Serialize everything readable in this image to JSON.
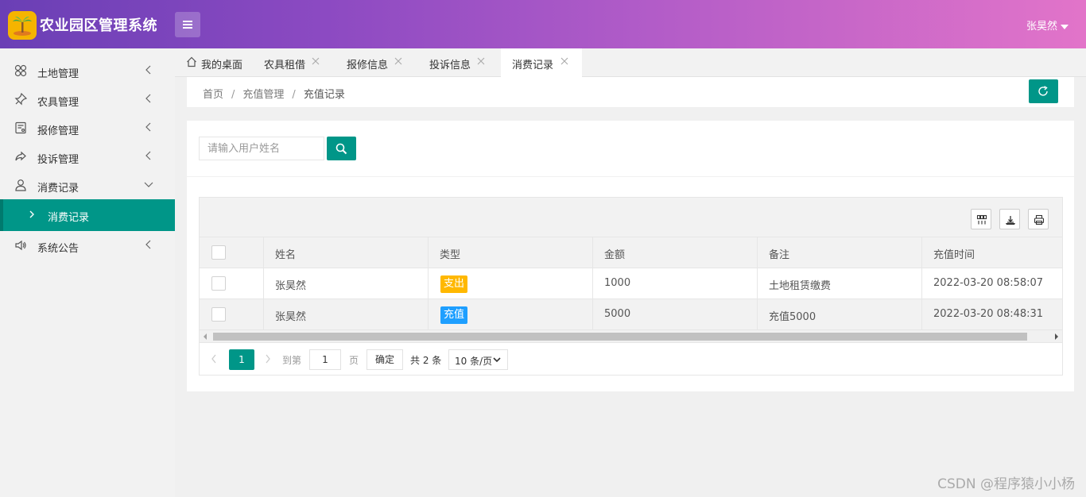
{
  "header": {
    "app_title": "农业园区管理系统",
    "user_name": "张昊然",
    "colors": {
      "gradient_start": "#6a3fb5",
      "gradient_end": "#e274c9",
      "logo_bg": "#f5b400"
    }
  },
  "sidebar": {
    "items": [
      {
        "label": "土地管理",
        "icon": "grid-clover-icon",
        "expanded": false
      },
      {
        "label": "农具管理",
        "icon": "pin-icon",
        "expanded": false
      },
      {
        "label": "报修管理",
        "icon": "form-icon",
        "expanded": false
      },
      {
        "label": "投诉管理",
        "icon": "share-arrow-icon",
        "expanded": false
      },
      {
        "label": "消费记录",
        "icon": "user-icon",
        "expanded": true
      },
      {
        "label": "系统公告",
        "icon": "speaker-icon",
        "expanded": false
      }
    ],
    "active_sub": {
      "label": "消费记录"
    },
    "accent": "#009688"
  },
  "tabs": [
    {
      "label": "我的桌面",
      "icon": "home-icon",
      "closable": false,
      "active": false
    },
    {
      "label": "农具租借",
      "closable": true,
      "active": false
    },
    {
      "label": "报修信息",
      "closable": true,
      "active": false
    },
    {
      "label": "投诉信息",
      "closable": true,
      "active": false
    },
    {
      "label": "消费记录",
      "closable": true,
      "active": true
    }
  ],
  "breadcrumb": {
    "items": [
      "首页",
      "充值管理",
      "充值记录"
    ],
    "separator": "/"
  },
  "search": {
    "placeholder": "请输入用户姓名",
    "value": ""
  },
  "table": {
    "toolbar_icons": [
      "columns-icon",
      "export-icon",
      "print-icon"
    ],
    "columns": [
      "姓名",
      "类型",
      "金额",
      "备注",
      "充值时间"
    ],
    "rows": [
      {
        "name": "张昊然",
        "type": "支出",
        "type_color": "#ffb800",
        "amount": "1000",
        "remark": "土地租赁缴费",
        "time": "2022-03-20 08:58:07"
      },
      {
        "name": "张昊然",
        "type": "充值",
        "type_color": "#1e9fff",
        "amount": "5000",
        "remark": "充值5000",
        "time": "2022-03-20 08:48:31"
      }
    ]
  },
  "pagination": {
    "current_page": "1",
    "goto_label": "到第",
    "goto_value": "1",
    "page_label": "页",
    "confirm_label": "确定",
    "total_label": "共 2 条",
    "page_size": "10 条/页"
  },
  "watermark": "CSDN @程序猿小小杨"
}
